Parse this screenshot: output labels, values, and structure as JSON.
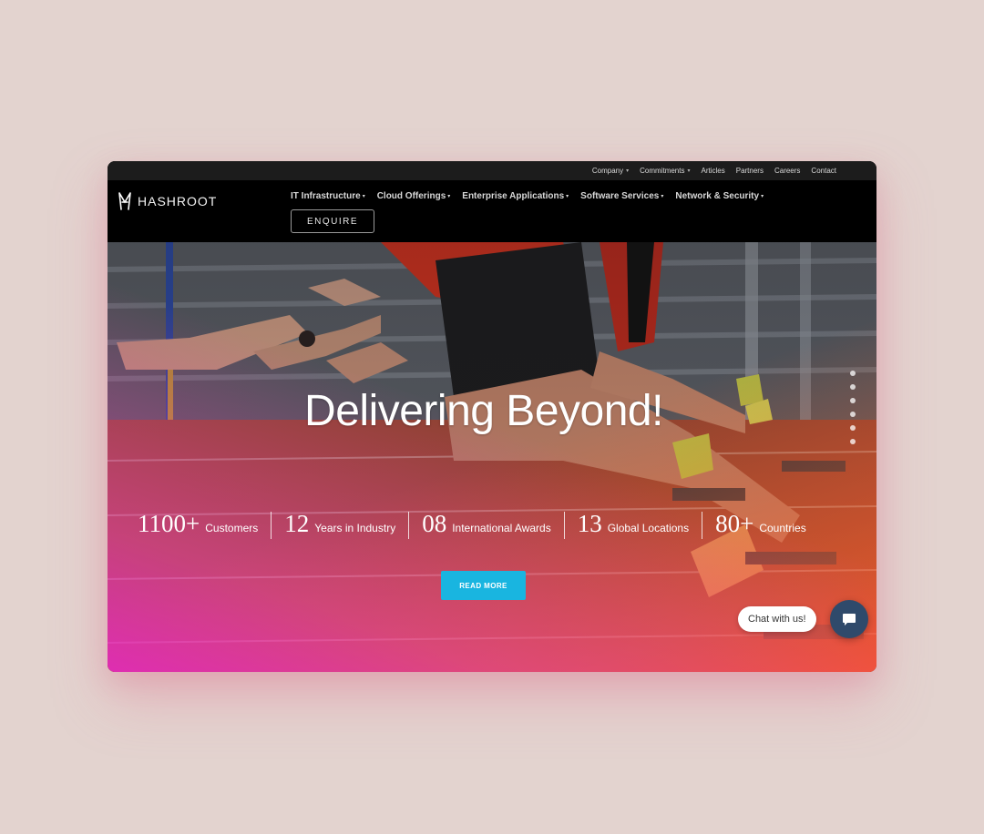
{
  "utility_nav": {
    "items": [
      {
        "label": "Company",
        "has_dropdown": true
      },
      {
        "label": "Commitments",
        "has_dropdown": true
      },
      {
        "label": "Articles",
        "has_dropdown": false
      },
      {
        "label": "Partners",
        "has_dropdown": false
      },
      {
        "label": "Careers",
        "has_dropdown": false
      },
      {
        "label": "Contact",
        "has_dropdown": false
      }
    ]
  },
  "brand": {
    "name": "HASHROOT"
  },
  "main_nav": {
    "items": [
      {
        "label": "IT Infrastructure"
      },
      {
        "label": "Cloud Offerings"
      },
      {
        "label": "Enterprise Applications"
      },
      {
        "label": "Software Services"
      },
      {
        "label": "Network & Security"
      }
    ],
    "enquire_label": "ENQUIRE"
  },
  "hero": {
    "title": "Delivering Beyond!",
    "stats": [
      {
        "number": "1100+",
        "label": "Customers"
      },
      {
        "number": "12",
        "label": "Years in Industry"
      },
      {
        "number": "08",
        "label": "International Awards"
      },
      {
        "number": "13",
        "label": "Global Locations"
      },
      {
        "number": "80+",
        "label": "Countries"
      }
    ],
    "cta_label": "READ MORE",
    "slide_count": 6
  },
  "chat": {
    "label": "Chat with us!"
  },
  "colors": {
    "accent": "#19b5e0",
    "chat_button": "#2f4a6b",
    "gradient_orange": "#ff5a14",
    "gradient_magenta": "#e628c8"
  }
}
